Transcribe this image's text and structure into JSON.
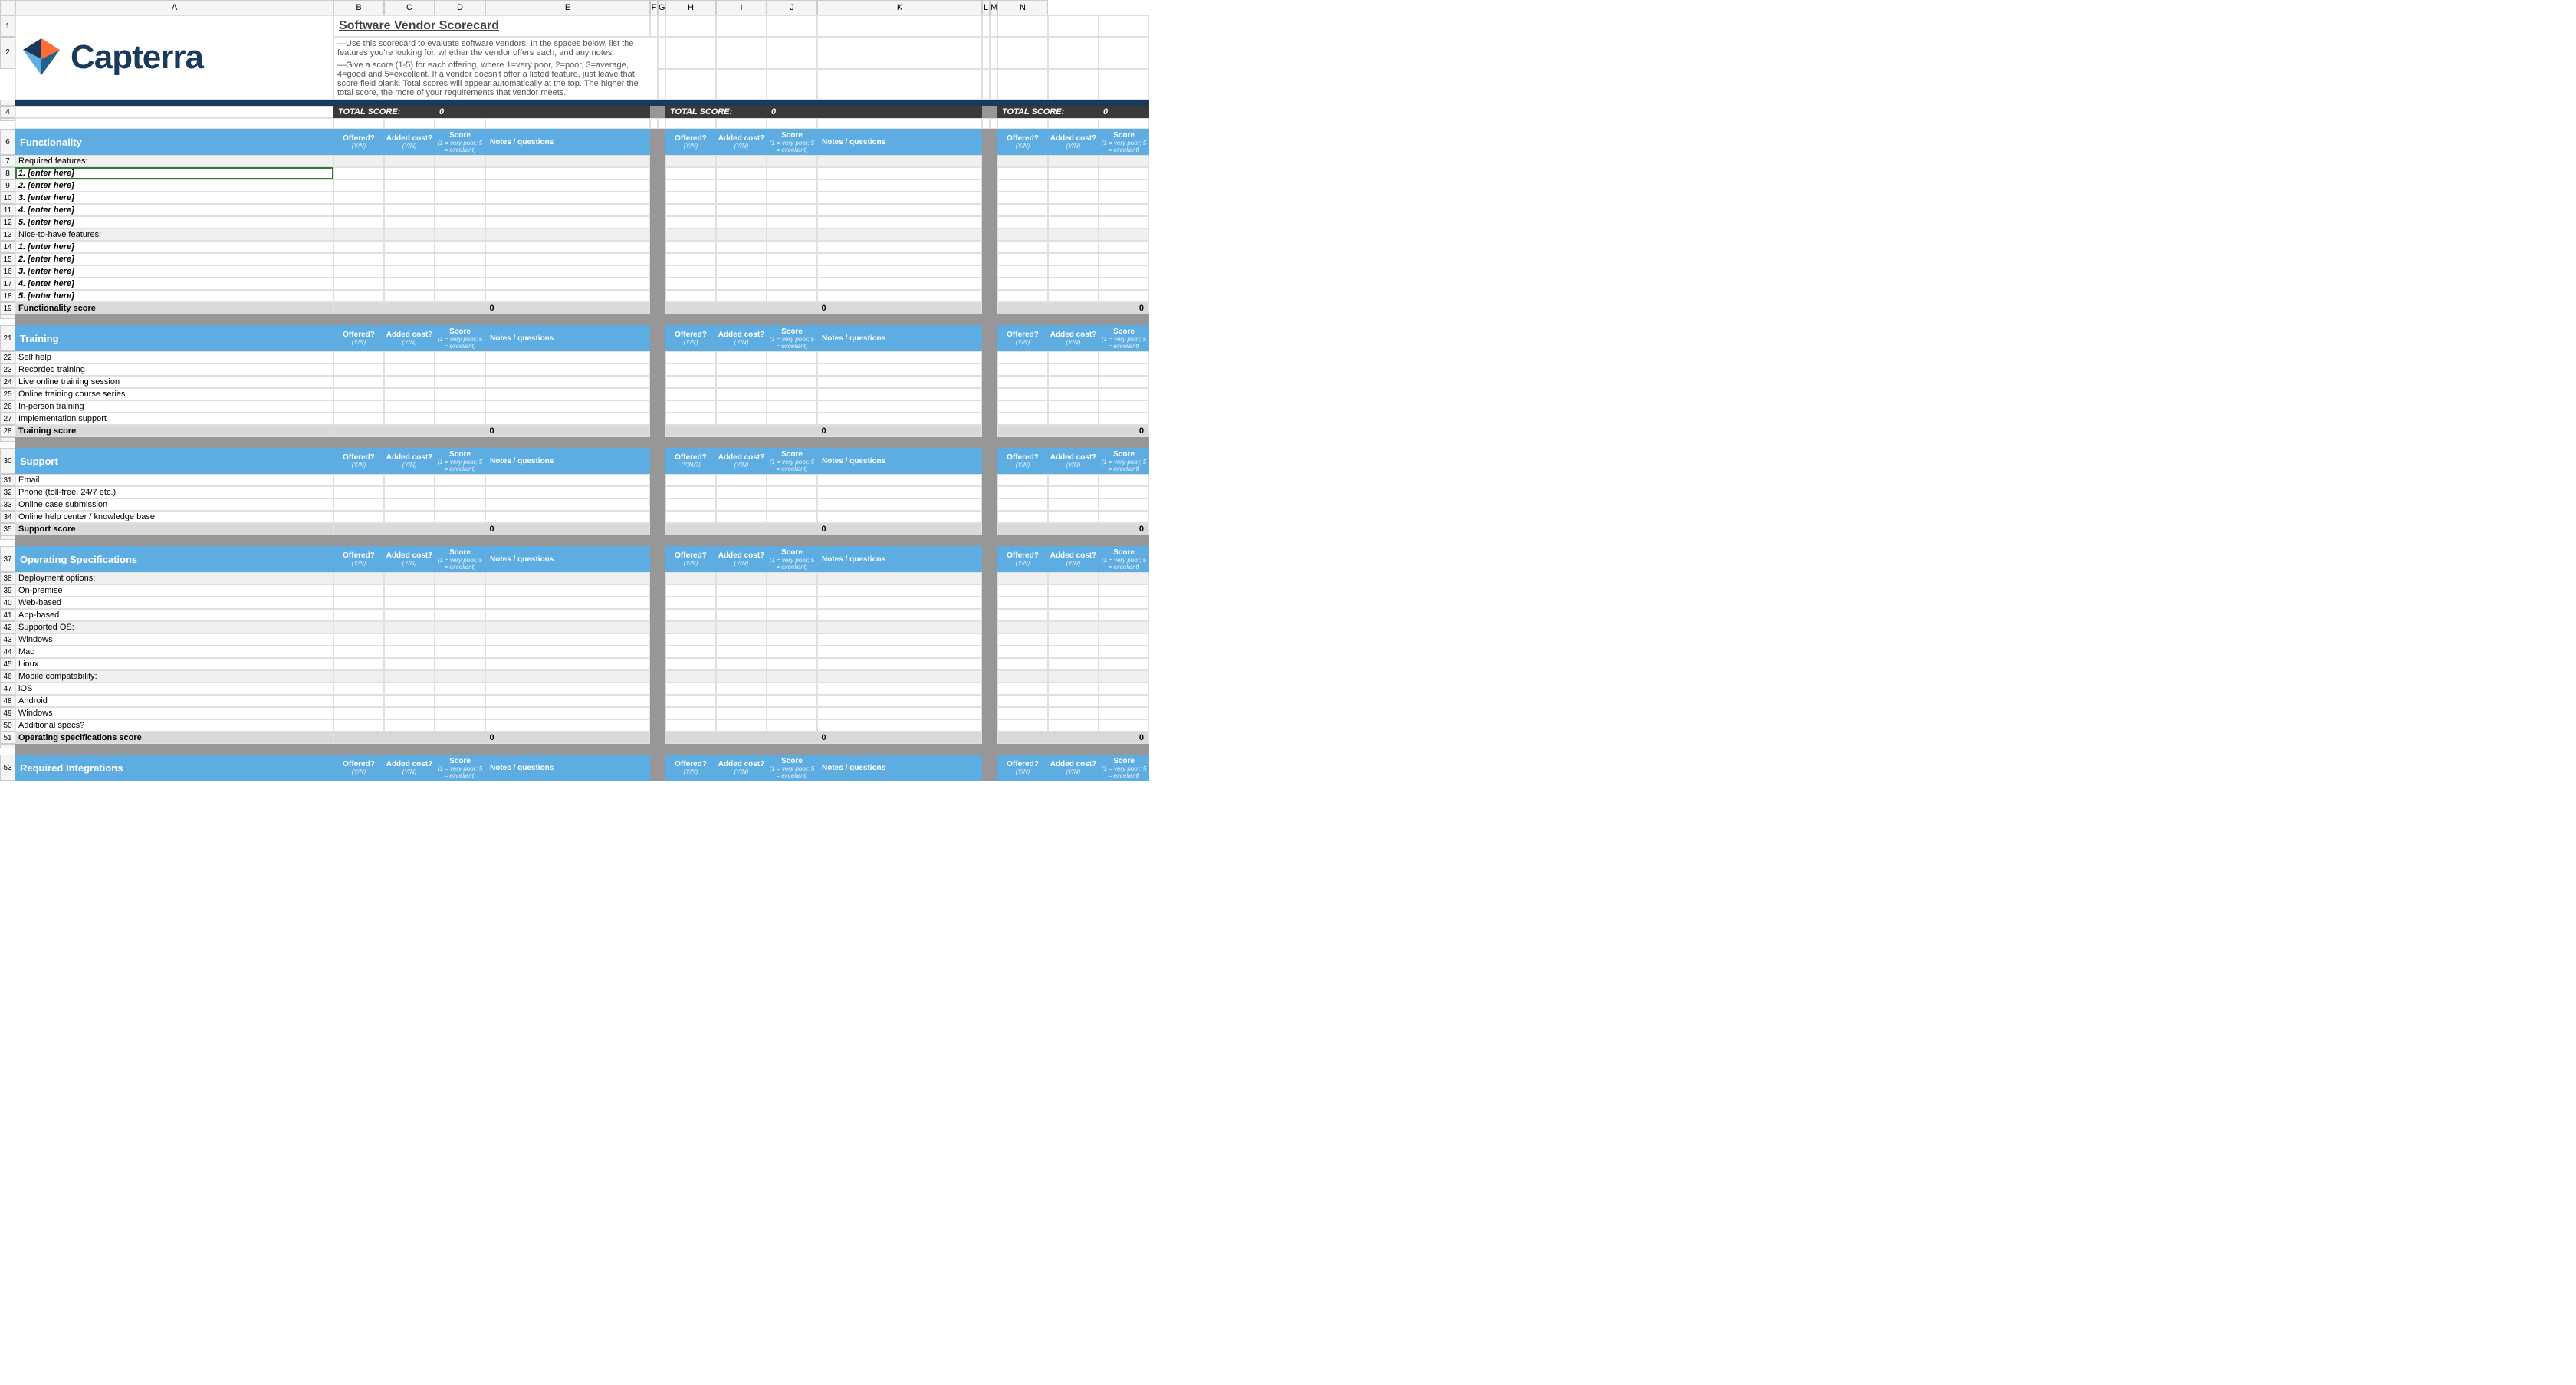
{
  "columns": [
    "",
    "A",
    "B",
    "C",
    "D",
    "E",
    "F",
    "G",
    "H",
    "I",
    "J",
    "K",
    "L",
    "M",
    "N"
  ],
  "logo_brand": "Capterra",
  "title": "Software Vendor Scorecard",
  "desc1": "—Use this scorecard to evaluate software vendors. In the spaces below, list the features you're looking for, whether the vendor offers each, and any notes.",
  "desc2": "—Give a score (1-5) for each offering, where 1=very poor, 2=poor, 3=average, 4=good and 5=excellent. If a vendor doesn't offer a listed feature, just leave that score field blank. Total scores will appear automatically at the top. The higher the total score, the more of your requirements that vendor meets.",
  "total_score_label": "TOTAL SCORE:",
  "total_score_val": "0",
  "headers": {
    "offered": "Offered?",
    "offered_sub": "(Y/N)",
    "offered_sub_alt": "(Y/N/?)",
    "added_cost": "Added cost?",
    "added_cost_sub": "(Y/N)",
    "score": "Score",
    "score_sub": "(1 = very poor; 5 = excellent)",
    "notes": "Notes / questions"
  },
  "sections": {
    "functionality": {
      "title": "Functionality",
      "required_label": "Required features:",
      "nice_label": "Nice-to-have features:",
      "entries": [
        "1.  [enter here]",
        "2.  [enter here]",
        "3.  [enter here]",
        "4.  [enter here]",
        "5.  [enter here]"
      ],
      "score_label": "Functionality score",
      "score_val": "0"
    },
    "training": {
      "title": "Training",
      "rows": [
        "Self help",
        "Recorded training",
        "Live online training session",
        "Online training course series",
        "In-person training",
        "Implementation support"
      ],
      "score_label": "Training score",
      "score_val": "0"
    },
    "support": {
      "title": "Support",
      "rows": [
        "Email",
        "Phone (toll-free, 24/7 etc.)",
        "Online case submission",
        "Online help center / knowledge base"
      ],
      "score_label": "Support score",
      "score_val": "0"
    },
    "opspec": {
      "title": "Operating Specifications",
      "rows": [
        {
          "t": "Deployment options:",
          "alt": true
        },
        {
          "t": "On-premise",
          "alt": false
        },
        {
          "t": "Web-based",
          "alt": false
        },
        {
          "t": "App-based",
          "alt": false
        },
        {
          "t": "Supported OS:",
          "alt": true
        },
        {
          "t": "Windows",
          "alt": false
        },
        {
          "t": "Mac",
          "alt": false
        },
        {
          "t": "Linux",
          "alt": false
        },
        {
          "t": "Mobile compatability:",
          "alt": true
        },
        {
          "t": "iOS",
          "alt": false
        },
        {
          "t": "Android",
          "alt": false
        },
        {
          "t": "Windows",
          "alt": false
        },
        {
          "t": "Additional specs?",
          "alt": false
        }
      ],
      "score_label": "Operating specifications score",
      "score_val": "0"
    },
    "integrations": {
      "title": "Required Integrations"
    }
  },
  "row_nums": {
    "r1": "1",
    "r2": "2",
    "r4": "4",
    "r6": "6",
    "r7": "7",
    "r8": "8",
    "r9": "9",
    "r10": "10",
    "r11": "11",
    "r12": "12",
    "r13": "13",
    "r14": "14",
    "r15": "15",
    "r16": "16",
    "r17": "17",
    "r18": "18",
    "r19": "19",
    "r21": "21",
    "r22": "22",
    "r23": "23",
    "r24": "24",
    "r25": "25",
    "r26": "26",
    "r27": "27",
    "r28": "28",
    "r30": "30",
    "r31": "31",
    "r32": "32",
    "r33": "33",
    "r34": "34",
    "r35": "35",
    "r37": "37",
    "r38": "38",
    "r39": "39",
    "r40": "40",
    "r41": "41",
    "r42": "42",
    "r43": "43",
    "r44": "44",
    "r45": "45",
    "r46": "46",
    "r47": "47",
    "r48": "48",
    "r49": "49",
    "r50": "50",
    "r51": "51",
    "r53": "53"
  }
}
